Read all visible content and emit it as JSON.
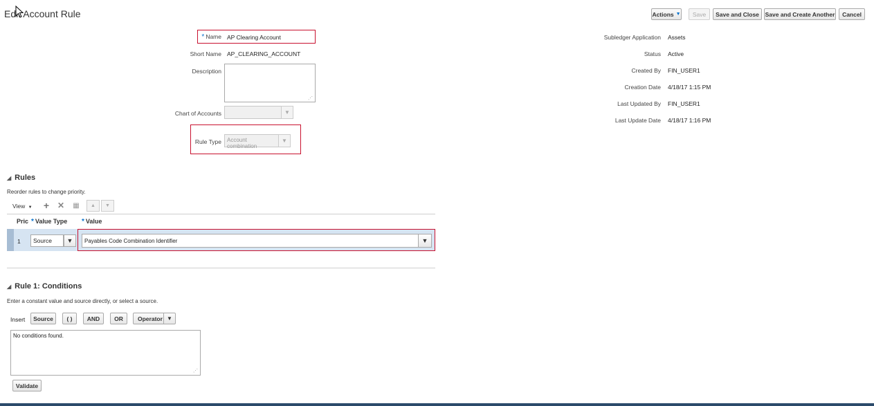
{
  "page": {
    "title": "Edit Account Rule"
  },
  "actions": {
    "actions_label": "Actions",
    "save_label": "Save",
    "save_close_label": "Save and Close",
    "save_create_label": "Save and Create Another",
    "cancel_label": "Cancel"
  },
  "form": {
    "name_label": "Name",
    "name_value": "AP Clearing Account",
    "short_name_label": "Short Name",
    "short_name_value": "AP_CLEARING_ACCOUNT",
    "description_label": "Description",
    "description_value": "",
    "coa_label": "Chart of Accounts",
    "coa_value": "",
    "rule_type_label": "Rule Type",
    "rule_type_value": "Account combination"
  },
  "info": {
    "subledger_label": "Subledger Application",
    "subledger_value": "Assets",
    "status_label": "Status",
    "status_value": "Active",
    "created_by_label": "Created By",
    "created_by_value": "FIN_USER1",
    "creation_date_label": "Creation Date",
    "creation_date_value": "4/18/17 1:15 PM",
    "last_updated_by_label": "Last Updated By",
    "last_updated_by_value": "FIN_USER1",
    "last_update_date_label": "Last Update Date",
    "last_update_date_value": "4/18/17 1:16 PM"
  },
  "rules": {
    "title": "Rules",
    "hint": "Reorder rules to change priority.",
    "view_label": "View",
    "columns": {
      "priority": "Pric",
      "value_type": "Value Type",
      "value": "Value"
    },
    "rows": [
      {
        "priority": "1",
        "value_type": "Source",
        "value": "Payables Code Combination Identifier"
      }
    ]
  },
  "conditions": {
    "title": "Rule 1: Conditions",
    "hint": "Enter a constant value and source directly, or select a source.",
    "insert_label": "Insert",
    "source_label": "Source",
    "paren_label": "( )",
    "and_label": "AND",
    "or_label": "OR",
    "operator_label": "Operator",
    "text": "No conditions found.",
    "validate_label": "Validate"
  },
  "colors": {
    "required": "#0572ce",
    "highlight": "#c8102e",
    "selected_row": "#d6e4f2"
  }
}
